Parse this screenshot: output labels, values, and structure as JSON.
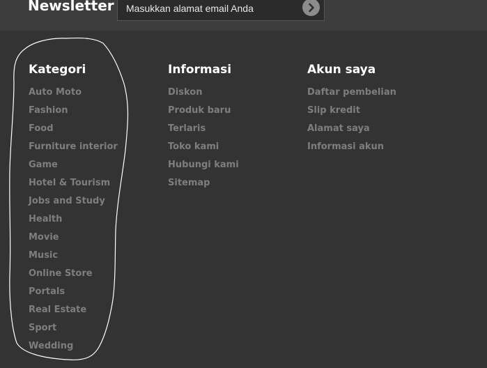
{
  "newsletter": {
    "title": "Newsletter",
    "input_placeholder": "Masukkan alamat email Anda"
  },
  "columns": [
    {
      "heading": "Kategori",
      "items": [
        "Auto Moto",
        "Fashion",
        "Food",
        "Furniture interior",
        "Game",
        "Hotel & Tourism",
        "Jobs and Study",
        "Health",
        "Movie",
        "Music",
        "Online Store",
        "Portals",
        "Real Estate",
        "Sport",
        "Wedding"
      ]
    },
    {
      "heading": "Informasi",
      "items": [
        "Diskon",
        "Produk baru",
        "Terlaris",
        "Toko kami",
        "Hubungi kami",
        "Sitemap"
      ]
    },
    {
      "heading": "Akun saya",
      "items": [
        "Daftar pembelian",
        "Slip kredit",
        "Alamat saya",
        "Informasi akun"
      ]
    }
  ],
  "colors": {
    "background": "#333333",
    "newsletter_bar": "#3d3d3d",
    "link": "#7e7e7e",
    "heading": "#ffffff"
  }
}
